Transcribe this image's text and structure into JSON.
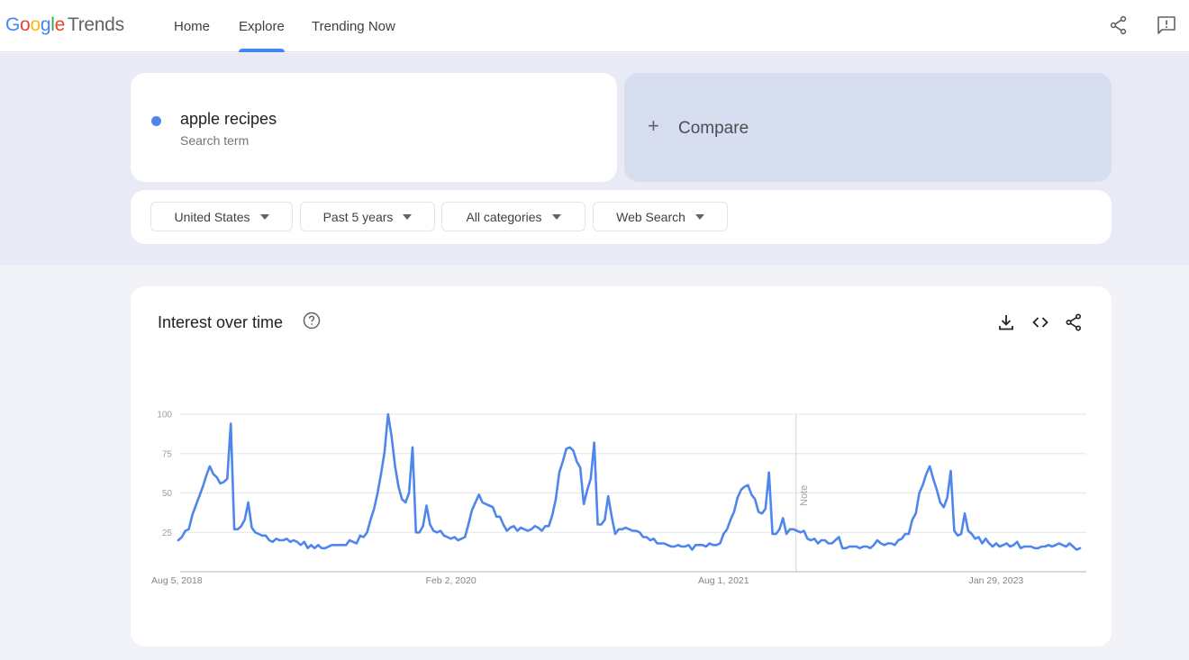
{
  "app": {
    "logo": {
      "google": [
        "G",
        "o",
        "o",
        "g",
        "l",
        "e"
      ],
      "product": "Trends"
    },
    "nav": [
      {
        "label": "Home",
        "active": false
      },
      {
        "label": "Explore",
        "active": true
      },
      {
        "label": "Trending Now",
        "active": false
      }
    ],
    "top_icons": [
      "share-icon",
      "feedback-icon"
    ],
    "accent_color": "#4285f4"
  },
  "search": {
    "term": "apple recipes",
    "term_type": "Search term",
    "term_color": "#4f86ec",
    "compare_label": "Compare",
    "compare_icon": "+"
  },
  "filters": [
    {
      "label": "United States"
    },
    {
      "label": "Past 5 years"
    },
    {
      "label": "All categories"
    },
    {
      "label": "Web Search"
    }
  ],
  "panel": {
    "title": "Interest over time",
    "help_icon": "help-icon",
    "actions": [
      "download-icon",
      "embed-icon",
      "share-icon"
    ]
  },
  "chart_data": {
    "type": "line",
    "title": "Interest over time",
    "xlabel": "",
    "ylabel": "",
    "ylim": [
      0,
      100
    ],
    "yticks": [
      25,
      50,
      75,
      100
    ],
    "grid": true,
    "legend": "none",
    "x_start": "Aug 5, 2018",
    "x_interval": "week",
    "xtick_labels": [
      {
        "label": "Aug 5, 2018",
        "index": 0
      },
      {
        "label": "Feb 2, 2020",
        "index": 78
      },
      {
        "label": "Aug 1, 2021",
        "index": 156
      },
      {
        "label": "Jan 29, 2023",
        "index": 234
      }
    ],
    "annotation": {
      "label": "Note",
      "index": 177
    },
    "series": [
      {
        "name": "apple recipes",
        "color": "#4f86ec",
        "values": [
          20,
          22,
          26,
          27,
          36,
          42,
          48,
          54,
          61,
          67,
          62,
          60,
          56,
          57,
          59,
          94,
          27,
          27,
          29,
          33,
          44,
          28,
          25,
          24,
          23,
          23,
          20,
          19,
          21,
          20,
          20,
          21,
          19,
          20,
          19,
          17,
          19,
          15,
          17,
          15,
          17,
          15,
          15,
          16,
          17,
          17,
          17,
          17,
          17,
          20,
          19,
          18,
          23,
          22,
          25,
          33,
          40,
          50,
          62,
          76,
          100,
          86,
          67,
          54,
          46,
          44,
          50,
          79,
          25,
          25,
          29,
          42,
          30,
          26,
          25,
          26,
          23,
          22,
          21,
          22,
          20,
          21,
          22,
          30,
          39,
          44,
          49,
          44,
          43,
          42,
          41,
          35,
          35,
          30,
          26,
          28,
          29,
          26,
          28,
          27,
          26,
          27,
          29,
          28,
          26,
          29,
          29,
          36,
          46,
          63,
          70,
          78,
          79,
          77,
          70,
          66,
          43,
          52,
          59,
          82,
          30,
          30,
          33,
          48,
          35,
          24,
          27,
          27,
          28,
          27,
          26,
          26,
          25,
          22,
          22,
          20,
          21,
          18,
          18,
          18,
          17,
          16,
          16,
          17,
          16,
          16,
          17,
          14,
          17,
          17,
          17,
          16,
          18,
          17,
          17,
          18,
          24,
          27,
          33,
          38,
          47,
          52,
          54,
          55,
          49,
          46,
          38,
          37,
          40,
          63,
          24,
          24,
          27,
          34,
          24,
          27,
          27,
          26,
          25,
          26,
          21,
          20,
          21,
          18,
          20,
          20,
          18,
          18,
          20,
          22,
          15,
          15,
          16,
          16,
          16,
          15,
          16,
          16,
          15,
          17,
          20,
          18,
          17,
          18,
          18,
          17,
          20,
          21,
          24,
          24,
          33,
          37,
          50,
          55,
          62,
          67,
          59,
          52,
          44,
          41,
          47,
          64,
          26,
          23,
          24,
          37,
          26,
          24,
          21,
          22,
          18,
          21,
          18,
          16,
          18,
          16,
          17,
          18,
          16,
          17,
          19,
          15,
          16,
          16,
          16,
          15,
          15,
          16,
          16,
          17,
          16,
          17,
          18,
          17,
          16,
          18,
          16,
          14,
          15
        ]
      }
    ]
  }
}
